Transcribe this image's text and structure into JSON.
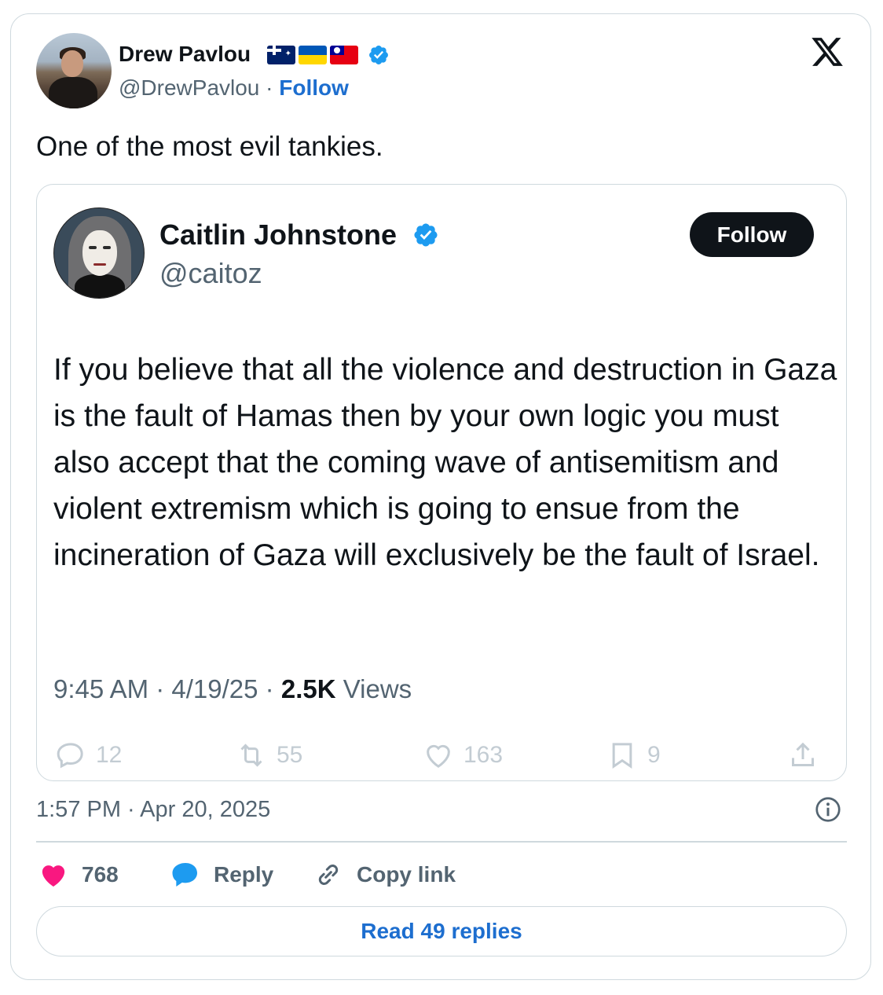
{
  "tweet": {
    "author": {
      "name": "Drew Pavlou",
      "handle": "@DrewPavlou",
      "separator": "·",
      "follow_label": "Follow",
      "flags": [
        "australia-flag",
        "ukraine-flag",
        "taiwan-flag"
      ],
      "verified": true
    },
    "text": "One of the most evil tankies.",
    "timestamp": "1:57 PM · Apr 20, 2025",
    "actions": {
      "like_count": "768",
      "reply_label": "Reply",
      "copy_link_label": "Copy link"
    },
    "read_replies_label": "Read 49 replies"
  },
  "quoted": {
    "author": {
      "name": "Caitlin Johnstone",
      "handle": "@caitoz",
      "follow_button": "Follow",
      "verified": true
    },
    "text": "If you believe that all the violence and destruction in Gaza is the fault of Hamas then by your own logic you must also accept that the coming wave of antisemitism and violent extremism which is going to ensue from the incineration of Gaza will exclusively be the fault of Israel.",
    "meta": {
      "time": "9:45 AM",
      "date": "4/19/25",
      "views_count": "2.5K",
      "views_label": "Views",
      "separator": " · "
    },
    "actions": {
      "replies": "12",
      "reposts": "55",
      "likes": "163",
      "bookmarks": "9"
    }
  },
  "colors": {
    "link": "#1d6ecf",
    "verified": "#1d9bf0",
    "like": "#f91880",
    "reply_bubble": "#1d9bf0",
    "muted": "#536471"
  },
  "icons": {
    "platform": "x-logo-icon",
    "info": "info-icon",
    "like": "heart-icon",
    "reply": "speech-bubble-icon",
    "copy": "link-icon",
    "share": "share-icon",
    "retweet": "retweet-icon",
    "bookmark": "bookmark-icon"
  }
}
